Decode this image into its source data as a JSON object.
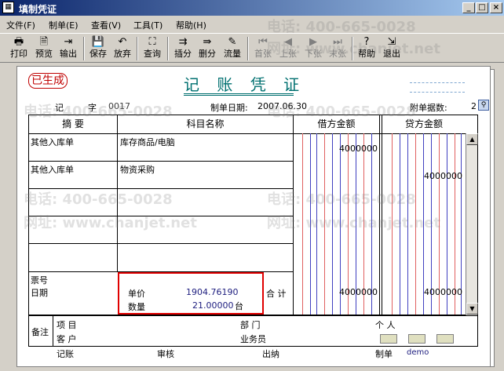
{
  "window": {
    "title": "填制凭证",
    "minimize": "_",
    "maximize": "□",
    "close": "×"
  },
  "menu": [
    {
      "label": "文件(F)"
    },
    {
      "label": "制单(E)"
    },
    {
      "label": "查看(V)"
    },
    {
      "label": "工具(T)"
    },
    {
      "label": "帮助(H)"
    }
  ],
  "toolbar": [
    {
      "label": "打印",
      "icon": "printer-icon",
      "glyph": "🖶"
    },
    {
      "label": "预览",
      "icon": "preview-icon",
      "glyph": "🗎"
    },
    {
      "label": "输出",
      "icon": "export-icon",
      "glyph": "⇥"
    },
    {
      "label": "保存",
      "icon": "save-icon",
      "glyph": "💾"
    },
    {
      "label": "放弃",
      "icon": "undo-icon",
      "glyph": "↶"
    },
    {
      "label": "查询",
      "icon": "binoculars-icon",
      "glyph": "⛶"
    },
    {
      "label": "插分",
      "icon": "insert-row-icon",
      "glyph": "⇉"
    },
    {
      "label": "删分",
      "icon": "delete-row-icon",
      "glyph": "⇛"
    },
    {
      "label": "流量",
      "icon": "cashflow-icon",
      "glyph": "✎"
    },
    {
      "label": "首张",
      "icon": "first-icon",
      "glyph": "⏮",
      "disabled": true
    },
    {
      "label": "上张",
      "icon": "prev-icon",
      "glyph": "◀",
      "disabled": true
    },
    {
      "label": "下张",
      "icon": "next-icon",
      "glyph": "▶",
      "disabled": true
    },
    {
      "label": "末张",
      "icon": "last-icon",
      "glyph": "⏭",
      "disabled": true
    },
    {
      "label": "帮助",
      "icon": "help-icon",
      "glyph": "?"
    },
    {
      "label": "退出",
      "icon": "exit-icon",
      "glyph": "⇲"
    }
  ],
  "watermark": {
    "phone": "电话: 400-665-0028",
    "site": "网址: www.chanjet.net"
  },
  "voucher": {
    "status": "已生成",
    "title": "记 账 凭 证",
    "type_label": "记",
    "no_label": "字",
    "number": "0017",
    "date_label": "制单日期:",
    "date": "2007.06.30",
    "attach_label": "附单据数:",
    "attach_count": "2",
    "columns": {
      "summary": "摘 要",
      "account": "科目名称",
      "debit": "借方金额",
      "credit": "贷方金额"
    },
    "rows": [
      {
        "summary": "其他入库单",
        "account": "库存商品/电脑",
        "debit": "4000000",
        "credit": ""
      },
      {
        "summary": "其他入库单",
        "account": "物资采购",
        "debit": "",
        "credit": "4000000"
      },
      {
        "summary": "",
        "account": "",
        "debit": "",
        "credit": ""
      },
      {
        "summary": "",
        "account": "",
        "debit": "",
        "credit": ""
      },
      {
        "summary": "",
        "account": "",
        "debit": "",
        "credit": ""
      }
    ],
    "bill_label": "票号",
    "date2_label": "日期",
    "price_label": "单价",
    "price": "1904.76190",
    "qty_label": "数量",
    "qty": "21.00000",
    "unit": "台",
    "total_label": "合 计",
    "total_debit": "4000000",
    "total_credit": "4000000",
    "remark_label": "备注",
    "project_label": "项 目",
    "dept_label": "部 门",
    "person_label": "个 人",
    "customer_label": "客 户",
    "salesman_label": "业务员",
    "bookkeeper_label": "记账",
    "auditor_label": "审核",
    "cashier_label": "出纳",
    "maker_label": "制单",
    "maker": "demo"
  }
}
